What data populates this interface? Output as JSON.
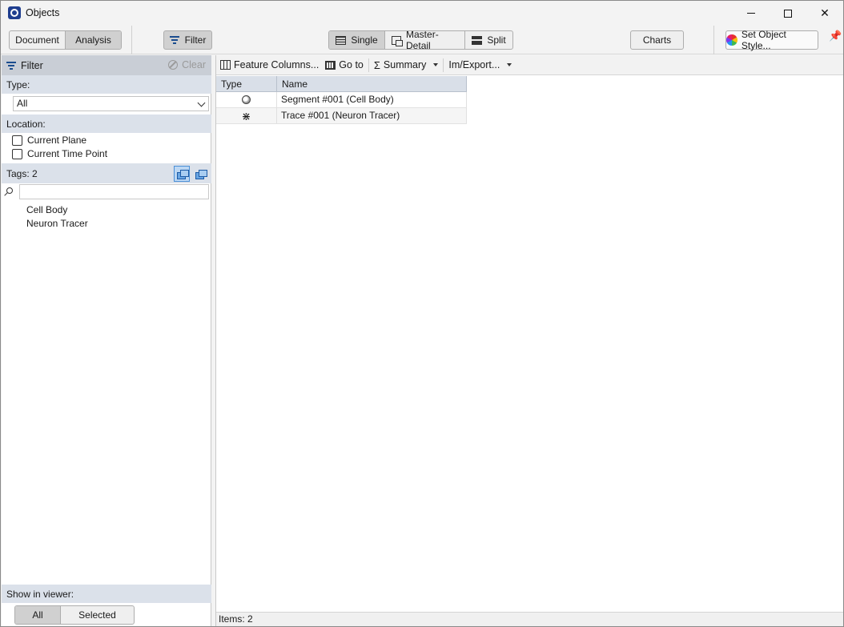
{
  "window": {
    "title": "Objects"
  },
  "toolbar": {
    "document_label": "Document",
    "analysis_label": "Analysis",
    "filter_label": "Filter",
    "view_single": "Single",
    "view_master_detail": "Master-Detail",
    "view_split": "Split",
    "charts_label": "Charts",
    "set_style_label": "Set Object Style..."
  },
  "filter_panel": {
    "title": "Filter",
    "clear_label": "Clear",
    "type_label": "Type:",
    "type_value": "All",
    "location_label": "Location:",
    "location_options": [
      "Current Plane",
      "Current Time Point"
    ],
    "tags_label": "Tags: 2",
    "search_placeholder": "",
    "tags": [
      "Cell Body",
      "Neuron Tracer"
    ],
    "show_in_viewer_label": "Show in viewer:",
    "show_all": "All",
    "show_selected": "Selected"
  },
  "list_toolbar": {
    "feature_columns": "Feature Columns...",
    "goto": "Go to",
    "summary": "Summary",
    "im_export": "Im/Export..."
  },
  "table": {
    "headers": [
      "Type",
      "Name"
    ],
    "rows": [
      {
        "type_icon": "segment-icon",
        "name": "Segment #001 (Cell Body)"
      },
      {
        "type_icon": "trace-icon",
        "name": "Trace #001 (Neuron Tracer)"
      }
    ]
  },
  "status": {
    "items": "Items: 2"
  }
}
